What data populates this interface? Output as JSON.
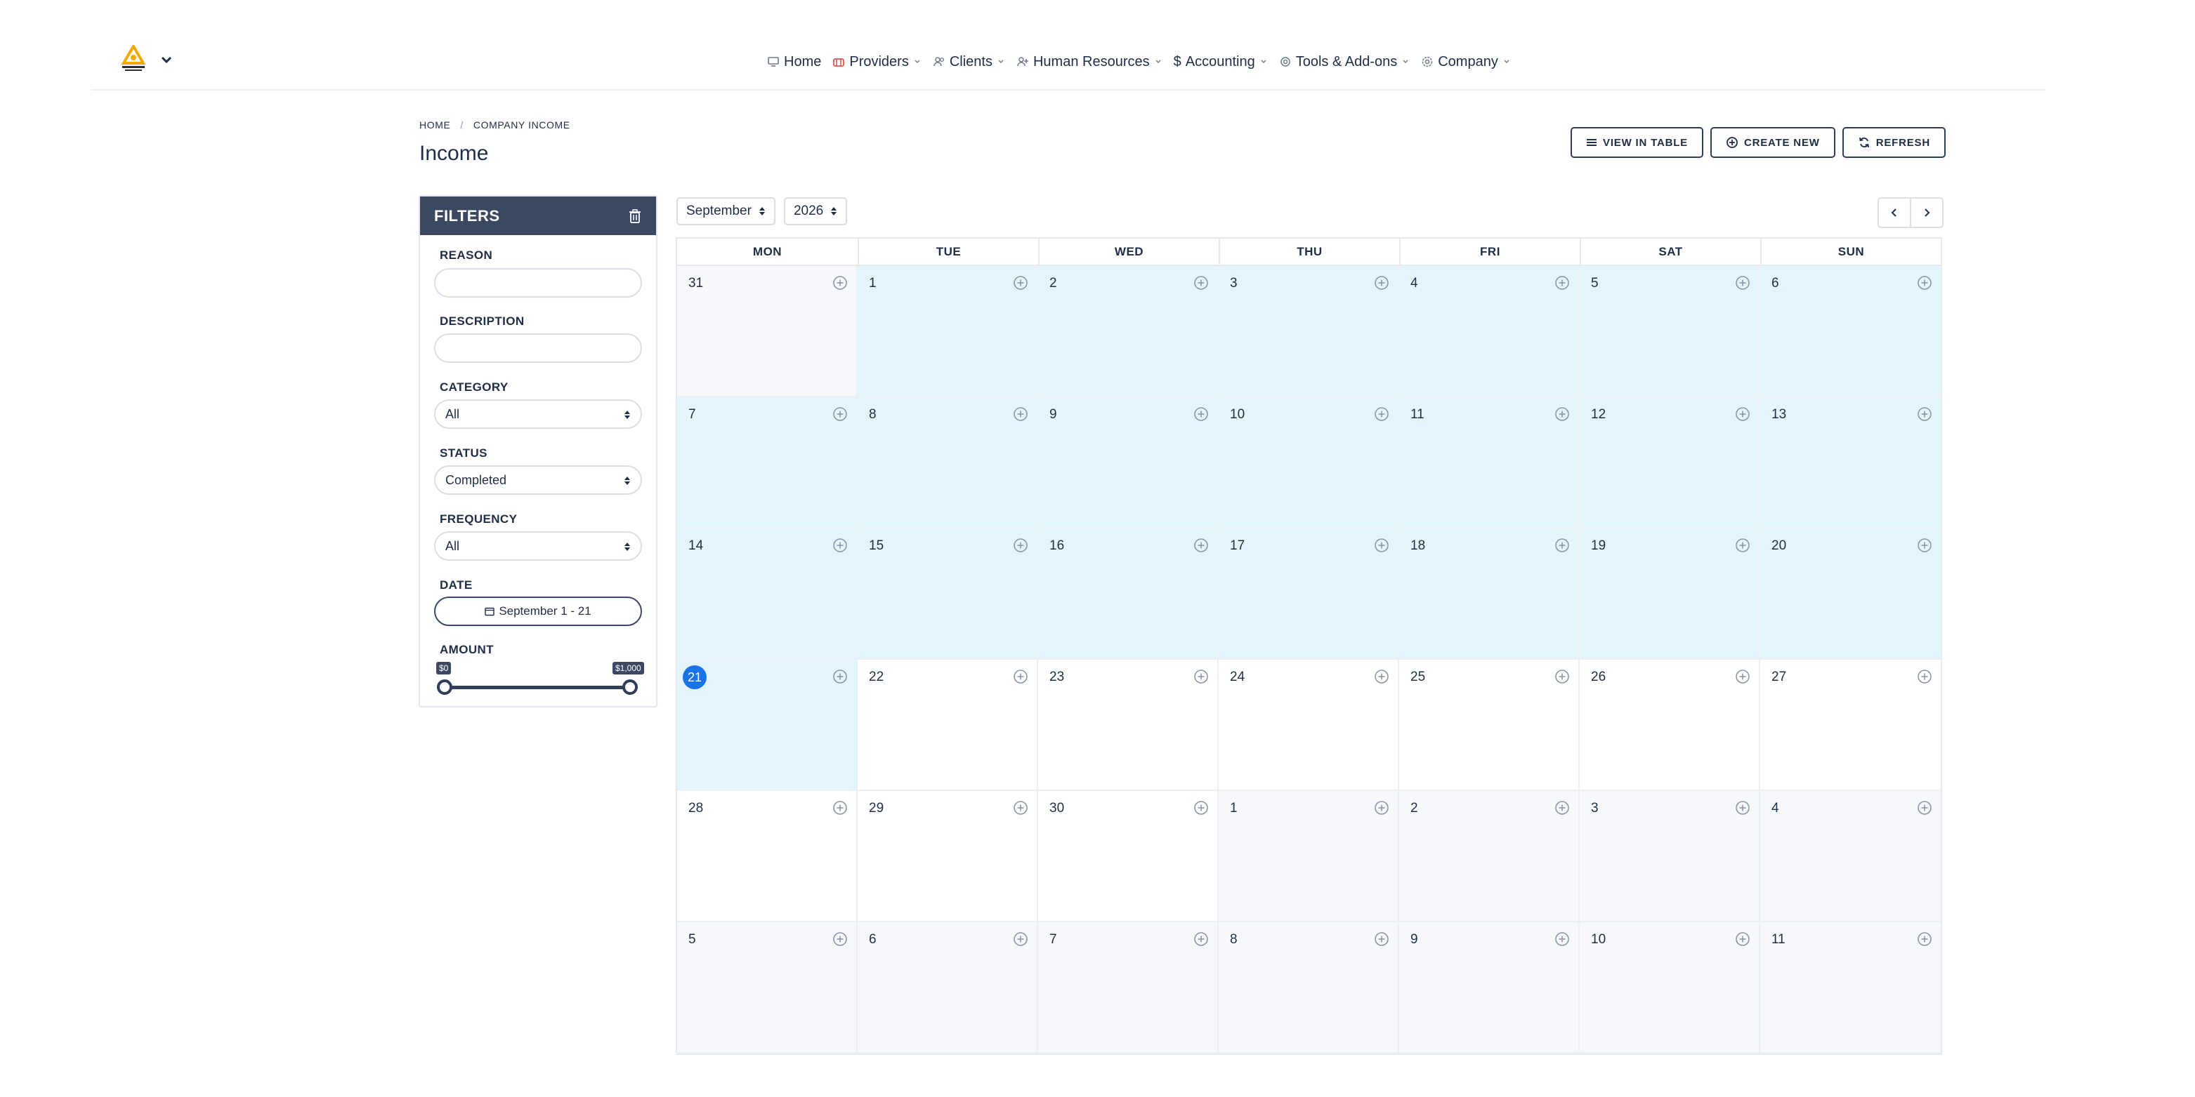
{
  "nav": {
    "items": [
      {
        "label": "Home",
        "icon": "monitor-icon",
        "dropdown": false
      },
      {
        "label": "Providers",
        "icon": "providers-icon",
        "dropdown": true
      },
      {
        "label": "Clients",
        "icon": "users-icon",
        "dropdown": true
      },
      {
        "label": "Human Resources",
        "icon": "user-plus-icon",
        "dropdown": true
      },
      {
        "label": "Accounting",
        "icon": "dollar-icon",
        "dropdown": true
      },
      {
        "label": "Tools & Add-ons",
        "icon": "tools-icon",
        "dropdown": true
      },
      {
        "label": "Company",
        "icon": "gear-icon",
        "dropdown": true
      }
    ]
  },
  "breadcrumb": {
    "home": "HOME",
    "current": "COMPANY INCOME"
  },
  "page": {
    "title": "Income"
  },
  "actions": {
    "view_table": "VIEW IN TABLE",
    "create_new": "CREATE NEW",
    "refresh": "REFRESH"
  },
  "filters": {
    "title": "FILTERS",
    "reason_label": "REASON",
    "reason_value": "",
    "description_label": "DESCRIPTION",
    "description_value": "",
    "category_label": "CATEGORY",
    "category_value": "All",
    "status_label": "STATUS",
    "status_value": "Completed",
    "frequency_label": "FREQUENCY",
    "frequency_value": "All",
    "date_label": "DATE",
    "date_value": "September 1 - 21",
    "amount_label": "AMOUNT",
    "amount_min": "$0",
    "amount_max": "$1,000"
  },
  "calendar": {
    "month": "September",
    "year": "2026",
    "weekdays": [
      "MON",
      "TUE",
      "WED",
      "THU",
      "FRI",
      "SAT",
      "SUN"
    ],
    "today": 21,
    "selected_range": [
      1,
      21
    ],
    "days": [
      {
        "d": "31",
        "m": "prev"
      },
      {
        "d": "1",
        "m": "cur"
      },
      {
        "d": "2",
        "m": "cur"
      },
      {
        "d": "3",
        "m": "cur"
      },
      {
        "d": "4",
        "m": "cur"
      },
      {
        "d": "5",
        "m": "cur"
      },
      {
        "d": "6",
        "m": "cur"
      },
      {
        "d": "7",
        "m": "cur"
      },
      {
        "d": "8",
        "m": "cur"
      },
      {
        "d": "9",
        "m": "cur"
      },
      {
        "d": "10",
        "m": "cur"
      },
      {
        "d": "11",
        "m": "cur"
      },
      {
        "d": "12",
        "m": "cur"
      },
      {
        "d": "13",
        "m": "cur"
      },
      {
        "d": "14",
        "m": "cur"
      },
      {
        "d": "15",
        "m": "cur"
      },
      {
        "d": "16",
        "m": "cur"
      },
      {
        "d": "17",
        "m": "cur"
      },
      {
        "d": "18",
        "m": "cur"
      },
      {
        "d": "19",
        "m": "cur"
      },
      {
        "d": "20",
        "m": "cur"
      },
      {
        "d": "21",
        "m": "cur"
      },
      {
        "d": "22",
        "m": "cur"
      },
      {
        "d": "23",
        "m": "cur"
      },
      {
        "d": "24",
        "m": "cur"
      },
      {
        "d": "25",
        "m": "cur"
      },
      {
        "d": "26",
        "m": "cur"
      },
      {
        "d": "27",
        "m": "cur"
      },
      {
        "d": "28",
        "m": "cur"
      },
      {
        "d": "29",
        "m": "cur"
      },
      {
        "d": "30",
        "m": "cur"
      },
      {
        "d": "1",
        "m": "next"
      },
      {
        "d": "2",
        "m": "next"
      },
      {
        "d": "3",
        "m": "next"
      },
      {
        "d": "4",
        "m": "next"
      },
      {
        "d": "5",
        "m": "next"
      },
      {
        "d": "6",
        "m": "next"
      },
      {
        "d": "7",
        "m": "next"
      },
      {
        "d": "8",
        "m": "next"
      },
      {
        "d": "9",
        "m": "next"
      },
      {
        "d": "10",
        "m": "next"
      },
      {
        "d": "11",
        "m": "next"
      }
    ]
  },
  "colors": {
    "primary_dark": "#3a4861",
    "range_highlight": "#e1f5fb",
    "outside_month": "#f6f8fb",
    "today": "#1a73e8",
    "logo_accent": "#f2a900"
  }
}
